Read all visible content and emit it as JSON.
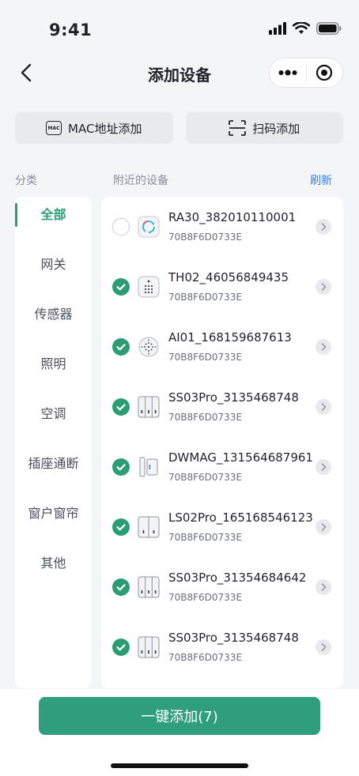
{
  "status_bar": {
    "time": "9:41"
  },
  "nav": {
    "title": "添加设备"
  },
  "add_buttons": {
    "mac": "MAC地址添加",
    "mac_icon_text": "MAC",
    "scan": "扫码添加"
  },
  "section": {
    "category_label": "分类",
    "nearby_label": "附近的设备",
    "refresh": "刷新"
  },
  "categories": [
    "全部",
    "网关",
    "传感器",
    "照明",
    "空调",
    "插座通断",
    "窗户窗帘",
    "其他"
  ],
  "devices": [
    {
      "name": "RA30_382010110001",
      "mac": "70B8F6D0733E",
      "checked": false,
      "icon": "ring-sensor-icon"
    },
    {
      "name": "TH02_46056849435",
      "mac": "70B8F6D0733E",
      "checked": true,
      "icon": "temp-humidity-icon"
    },
    {
      "name": "AI01_168159687613",
      "mac": "70B8F6D0733E",
      "checked": true,
      "icon": "round-sensor-icon"
    },
    {
      "name": "SS03Pro_3135468748",
      "mac": "70B8F6D0733E",
      "checked": true,
      "icon": "triple-switch-icon"
    },
    {
      "name": "DWMAG_131564687961",
      "mac": "70B8F6D0733E",
      "checked": true,
      "icon": "door-magnet-icon"
    },
    {
      "name": "LS02Pro_165168546123",
      "mac": "70B8F6D0733E",
      "checked": true,
      "icon": "double-switch-icon"
    },
    {
      "name": "SS03Pro_31354684642",
      "mac": "70B8F6D0733E",
      "checked": true,
      "icon": "triple-switch-icon"
    },
    {
      "name": "SS03Pro_3135468748",
      "mac": "70B8F6D0733E",
      "checked": true,
      "icon": "triple-switch-icon"
    }
  ],
  "action": {
    "label": "一键添加(7)"
  },
  "colors": {
    "accent": "#2f9e7a",
    "link": "#2f80ed"
  }
}
